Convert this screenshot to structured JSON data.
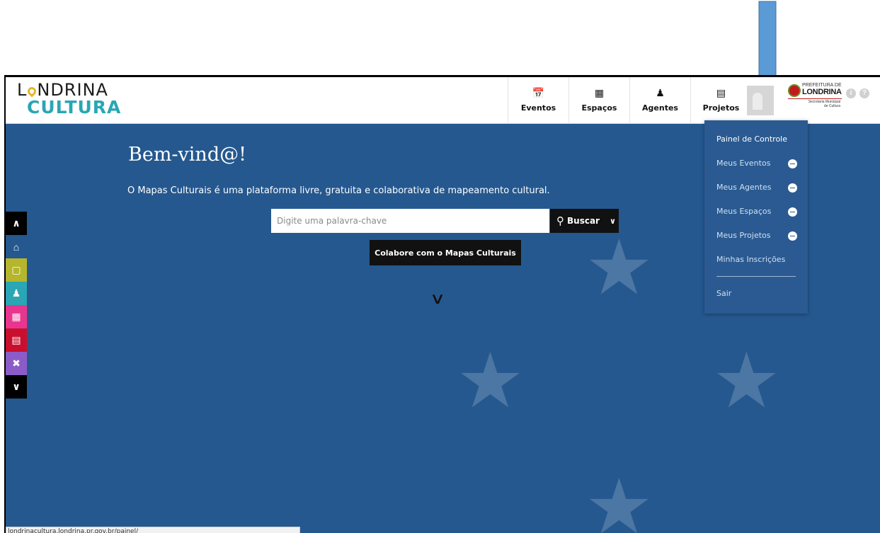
{
  "logo": {
    "line1_a": "L",
    "line1_b": "NDRINA",
    "line2": "CULTURA"
  },
  "nav": [
    {
      "label": "Eventos",
      "icon": "calendar-icon"
    },
    {
      "label": "Espaços",
      "icon": "building-icon"
    },
    {
      "label": "Agentes",
      "icon": "person-icon"
    },
    {
      "label": "Projetos",
      "icon": "document-icon"
    }
  ],
  "prefeitura": {
    "line1": "PREFEITURA DE",
    "line2": "LONDRINA",
    "line3": "Secretaria Municipal de Cultura"
  },
  "hero": {
    "title": "Bem-vind@!",
    "subtitle": "O Mapas Culturais é uma plataforma livre, gratuita e colaborativa de mapeamento cultural.",
    "search_placeholder": "Digite uma palavra-chave",
    "search_button": "Buscar",
    "collab_button": "Colabore com o Mapas Culturais"
  },
  "rail": {
    "colors": [
      "#000000",
      "#25588f",
      "#b5b62b",
      "#2aa6b4",
      "#e8368f",
      "#c8102e",
      "#8b5cc8",
      "#000000"
    ],
    "icons": [
      "chevron-up-icon",
      "home-icon",
      "calendar-icon",
      "person-icon",
      "building-icon",
      "document-icon",
      "tools-icon",
      "chevron-down-icon"
    ]
  },
  "dropdown": {
    "panel": "Painel de Controle",
    "eventos": "Meus Eventos",
    "agentes": "Meus Agentes",
    "espacos": "Meus Espaços",
    "projetos": "Meus Projetos",
    "inscricoes": "Minhas Inscrições",
    "sair": "Sair"
  },
  "status_bar": "londrinacultura.londrina.pr.gov.br/painel/",
  "colors": {
    "hero_bg": "#25588f",
    "dropdown_bg": "#2a5a91",
    "arrow": "#5b9bd5",
    "logo_accent": "#2aa6b4"
  }
}
